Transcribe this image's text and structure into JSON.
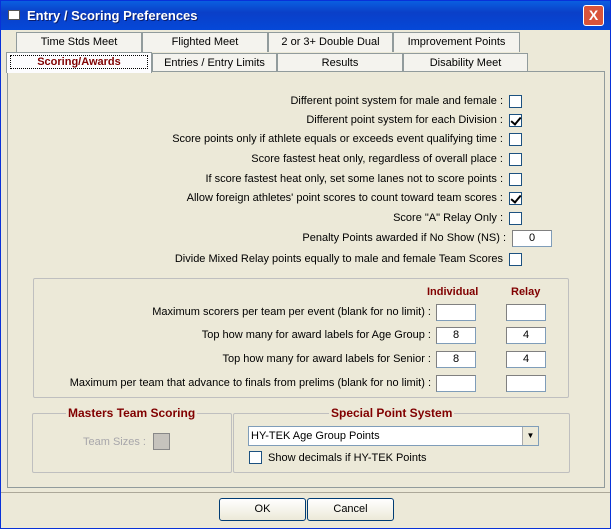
{
  "window": {
    "title": "Entry / Scoring Preferences",
    "close": "X"
  },
  "tabs_row1": [
    "Time Stds Meet",
    "Flighted Meet",
    "2 or 3+ Double Dual",
    "Improvement Points"
  ],
  "tabs_row2": [
    "Scoring/Awards",
    "Entries / Entry Limits",
    "Results",
    "Disability Meet"
  ],
  "active_tab": "Scoring/Awards",
  "options": [
    {
      "label": "Different point system for male and female :",
      "checked": false
    },
    {
      "label": "Different point system for each Division :",
      "checked": true
    },
    {
      "label": "Score points only if athlete equals or exceeds event qualifying time :",
      "checked": false
    },
    {
      "label": "Score fastest heat only, regardless of overall place :",
      "checked": false
    },
    {
      "label": "If score fastest heat only, set some lanes not to score points :",
      "checked": false
    },
    {
      "label": "Allow foreign athletes' point scores to count toward team scores :",
      "checked": true
    },
    {
      "label": "Score \"A\" Relay Only :",
      "checked": false
    }
  ],
  "penalty": {
    "label": "Penalty Points awarded if No Show (NS) :",
    "value": "0"
  },
  "divide_mixed": {
    "label": "Divide Mixed Relay points equally to male and female Team Scores",
    "checked": false
  },
  "limits": {
    "col_individual": "Individual",
    "col_relay": "Relay",
    "rows": [
      {
        "label": "Maximum scorers per team per event (blank for no limit) :",
        "individual": "",
        "relay": ""
      },
      {
        "label": "Top how many for award labels for Age Group :",
        "individual": "8",
        "relay": "4"
      },
      {
        "label": "Top how many for award labels for Senior :",
        "individual": "8",
        "relay": "4"
      },
      {
        "label": "Maximum per team that advance to finals from prelims (blank for no limit) :",
        "individual": "",
        "relay": ""
      }
    ]
  },
  "masters": {
    "title": "Masters Team Scoring",
    "team_sizes": "Team Sizes :"
  },
  "special": {
    "title": "Special Point System",
    "selected": "HY-TEK Age Group Points",
    "show_decimals": "Show decimals if HY-TEK Points",
    "show_decimals_checked": false
  },
  "buttons": {
    "ok": "OK",
    "cancel": "Cancel"
  }
}
